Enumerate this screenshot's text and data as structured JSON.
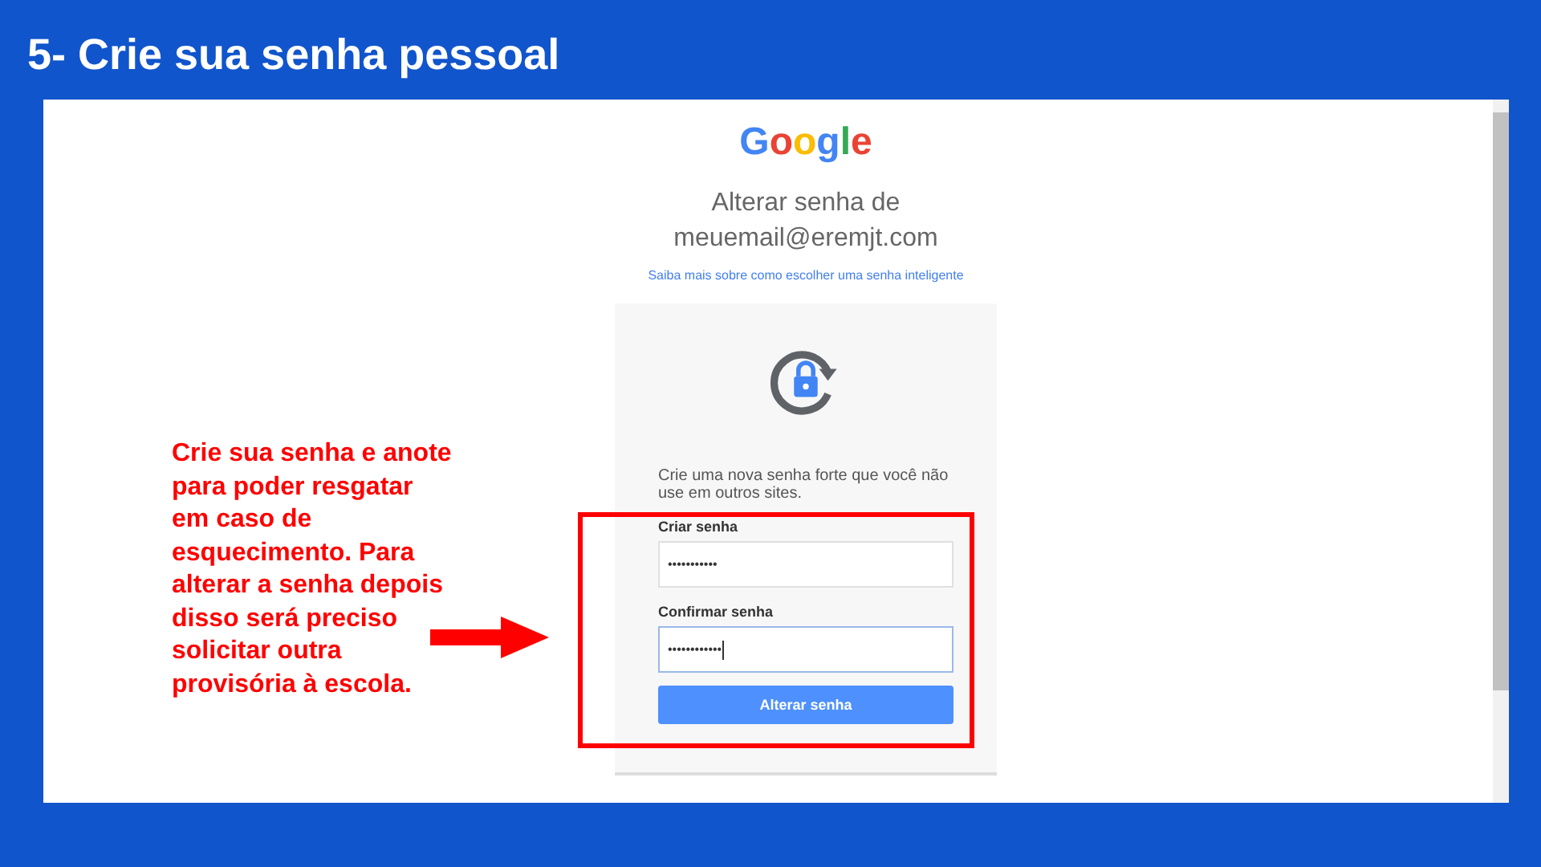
{
  "slide_title": "5- Crie sua senha pessoal",
  "page": {
    "logo": "Google",
    "heading_lines": [
      "Alterar senha de",
      "meuemail@eremjt.com"
    ],
    "help_link": "Saiba mais sobre como escolher uma senha inteligente",
    "card": {
      "intro": "Crie uma nova senha forte que você não use em outros sites.",
      "fields": [
        {
          "label": "Criar senha",
          "value": "•••••••••••",
          "focused": false
        },
        {
          "label": "Confirmar senha",
          "value": "••••••••••••",
          "focused": true
        }
      ],
      "button": "Alterar senha"
    }
  },
  "annotation": {
    "note": "Crie sua senha e anote para poder resgatar em caso de esquecimento. Para alterar a senha depois disso será preciso solicitar outra provisória à escola."
  }
}
